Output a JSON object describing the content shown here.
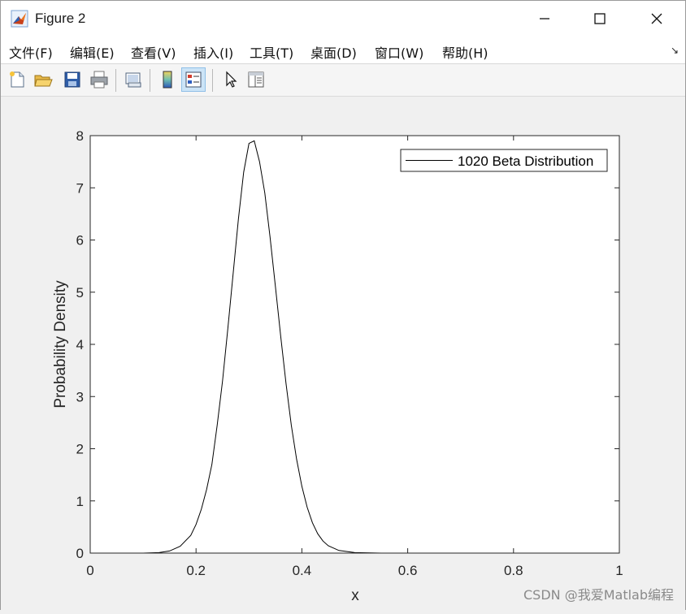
{
  "window": {
    "title": "Figure 2",
    "icon": "matlab-logo-icon",
    "controls": [
      "minimize-icon",
      "maximize-icon",
      "close-icon"
    ]
  },
  "menu": {
    "items": [
      {
        "label": "文件(F)"
      },
      {
        "label": "编辑(E)"
      },
      {
        "label": "查看(V)"
      },
      {
        "label": "插入(I)"
      },
      {
        "label": "工具(T)"
      },
      {
        "label": "桌面(D)"
      },
      {
        "label": "窗口(W)"
      },
      {
        "label": "帮助(H)"
      }
    ],
    "dock_arrow": "↘"
  },
  "toolbar": {
    "buttons": [
      {
        "icon": "new-figure-icon"
      },
      {
        "icon": "open-file-icon"
      },
      {
        "icon": "save-icon"
      },
      {
        "icon": "print-icon"
      },
      {
        "icon": "link-plot-icon"
      },
      {
        "icon": "insert-colorbar-icon"
      },
      {
        "icon": "insert-legend-icon",
        "active": true
      },
      {
        "icon": "edit-plot-arrow-icon"
      },
      {
        "icon": "property-inspector-icon"
      }
    ]
  },
  "chart_data": {
    "type": "line",
    "title": "",
    "xlabel": "x",
    "ylabel": "Probability Density",
    "xlim": [
      0,
      1
    ],
    "ylim": [
      0,
      8
    ],
    "xticks": [
      "0",
      "0.2",
      "0.4",
      "0.6",
      "0.8",
      "1"
    ],
    "yticks": [
      "0",
      "1",
      "2",
      "3",
      "4",
      "5",
      "6",
      "7",
      "8"
    ],
    "grid": false,
    "legend": {
      "placement": "top-right",
      "entries": [
        "1020 Beta Distribution"
      ]
    },
    "series": [
      {
        "name": "1020 Beta Distribution",
        "color": "#000000",
        "x": [
          0,
          0.05,
          0.1,
          0.13,
          0.15,
          0.17,
          0.19,
          0.2,
          0.21,
          0.22,
          0.23,
          0.24,
          0.25,
          0.26,
          0.27,
          0.28,
          0.29,
          0.3,
          0.31,
          0.32,
          0.33,
          0.34,
          0.35,
          0.36,
          0.37,
          0.38,
          0.39,
          0.4,
          0.41,
          0.42,
          0.43,
          0.44,
          0.45,
          0.47,
          0.5,
          0.55,
          0.6,
          0.7,
          0.8,
          0.9,
          1.0
        ],
        "y": [
          0,
          0,
          0,
          0.01,
          0.04,
          0.13,
          0.34,
          0.55,
          0.84,
          1.22,
          1.7,
          2.45,
          3.3,
          4.3,
          5.35,
          6.4,
          7.3,
          7.85,
          7.9,
          7.5,
          6.9,
          6.05,
          5.1,
          4.15,
          3.25,
          2.45,
          1.8,
          1.28,
          0.88,
          0.58,
          0.37,
          0.23,
          0.14,
          0.05,
          0.01,
          0,
          0,
          0,
          0,
          0,
          0
        ]
      }
    ]
  },
  "watermark": "CSDN @我爱Matlab编程"
}
